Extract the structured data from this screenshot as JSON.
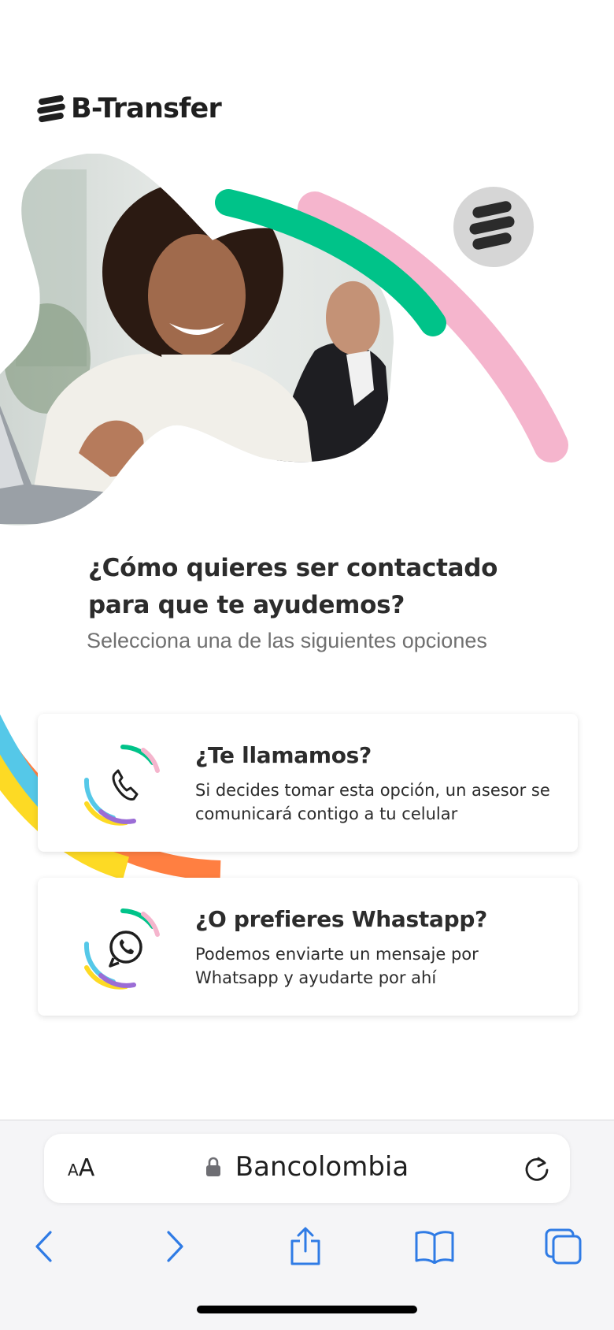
{
  "brand": {
    "name": "B-Transfer"
  },
  "main": {
    "title_line1": "¿Cómo quieres ser contactado",
    "title_line2": "para que te ayudemos?",
    "subtitle": "Selecciona una de las siguientes opciones"
  },
  "options": [
    {
      "title": "¿Te llamamos?",
      "description": "Si decides tomar esta opción, un asesor se comunicará contigo a tu celular",
      "icon": "phone-icon"
    },
    {
      "title": "¿O prefieres Whastapp?",
      "description": "Podemos enviarte un mensaje por Whatsapp y ayudarte por ahí",
      "icon": "whatsapp-icon"
    }
  ],
  "browser": {
    "text_size_small": "A",
    "text_size_big": "A",
    "domain": "Bancolombia",
    "icons": [
      "text-size-icon",
      "lock-icon",
      "reload-icon",
      "back-icon",
      "forward-icon",
      "share-icon",
      "bookmarks-icon",
      "tabs-icon"
    ]
  },
  "colors": {
    "green": "#00c389",
    "pink": "#f5b5cd",
    "blue": "#55c8e8",
    "yellow": "#fdda24",
    "orange": "#ff7f41",
    "purple": "#9b6dd6",
    "ios_blue": "#2f7be5"
  }
}
